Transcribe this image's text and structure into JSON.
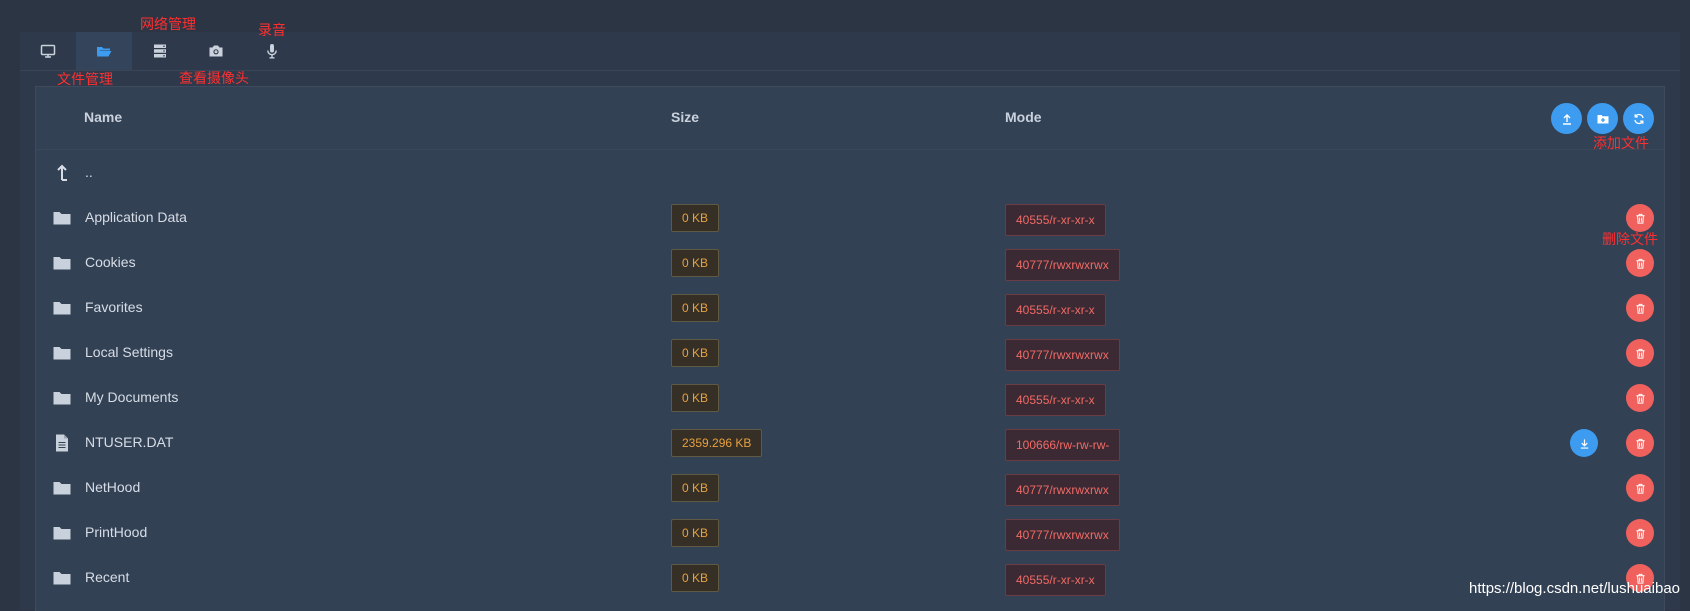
{
  "tabs": [
    {
      "icon": "monitor-icon",
      "active": false
    },
    {
      "icon": "folder-open-icon",
      "active": true
    },
    {
      "icon": "server-icon",
      "active": false
    },
    {
      "icon": "camera-icon",
      "active": false
    },
    {
      "icon": "microphone-icon",
      "active": false
    }
  ],
  "annotations": {
    "file_manage": "文件管理",
    "network_manage": "网络管理",
    "view_camera": "查看摄像头",
    "recording": "录音",
    "add_file": "添加文件",
    "delete_file": "删除文件"
  },
  "table": {
    "headers": {
      "name": "Name",
      "size": "Size",
      "mode": "Mode"
    },
    "parent": "..",
    "rows": [
      {
        "type": "folder",
        "name": "Application Data",
        "size": "0 KB",
        "mode": "40555/r-xr-xr-x"
      },
      {
        "type": "folder",
        "name": "Cookies",
        "size": "0 KB",
        "mode": "40777/rwxrwxrwx"
      },
      {
        "type": "folder",
        "name": "Favorites",
        "size": "0 KB",
        "mode": "40555/r-xr-xr-x"
      },
      {
        "type": "folder",
        "name": "Local Settings",
        "size": "0 KB",
        "mode": "40777/rwxrwxrwx"
      },
      {
        "type": "folder",
        "name": "My Documents",
        "size": "0 KB",
        "mode": "40555/r-xr-xr-x"
      },
      {
        "type": "file",
        "name": "NTUSER.DAT",
        "size": "2359.296 KB",
        "mode": "100666/rw-rw-rw-"
      },
      {
        "type": "folder",
        "name": "NetHood",
        "size": "0 KB",
        "mode": "40777/rwxrwxrwx"
      },
      {
        "type": "folder",
        "name": "PrintHood",
        "size": "0 KB",
        "mode": "40777/rwxrwxrwx"
      },
      {
        "type": "folder",
        "name": "Recent",
        "size": "0 KB",
        "mode": "40555/r-xr-xr-x"
      }
    ]
  },
  "watermark": "https://blog.csdn.net/lushuaibao",
  "colors": {
    "accent": "#3d9cf0",
    "danger": "#f0615d",
    "annotation": "#ff2f2f"
  }
}
